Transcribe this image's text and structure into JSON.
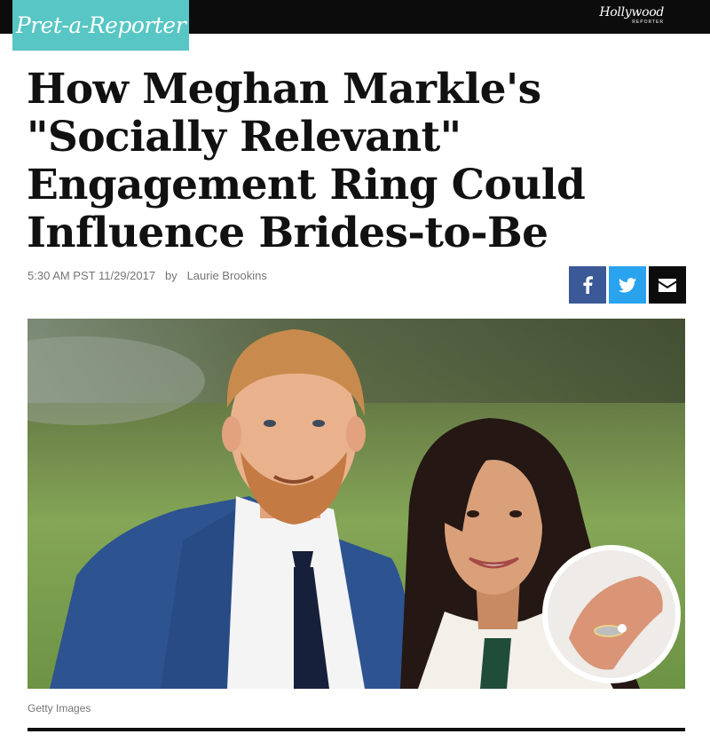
{
  "header": {
    "section_label": "Pret-a-Reporter",
    "brand_name": "Hollywood",
    "brand_sub": "REPORTER"
  },
  "article": {
    "headline_lines": [
      "How Meghan Markle's",
      "\"Socially Relevant\"",
      "Engagement Ring Could",
      "Influence Brides-to-Be"
    ],
    "timestamp": "5:30 AM PST 11/29/2017",
    "byline_prefix": "by",
    "author": "Laurie Brookins",
    "photo_credit": "Getty Images"
  },
  "share": {
    "buttons": [
      {
        "icon": "facebook-icon",
        "color": "#3b5897"
      },
      {
        "icon": "twitter-icon",
        "color": "#2aa3ef"
      },
      {
        "icon": "email-icon",
        "color": "#0c0c0c"
      }
    ]
  },
  "colors": {
    "section_accent": "#57c6c4",
    "topbar": "#0c0c0c",
    "headline": "#111111",
    "meta_text": "#757575"
  }
}
